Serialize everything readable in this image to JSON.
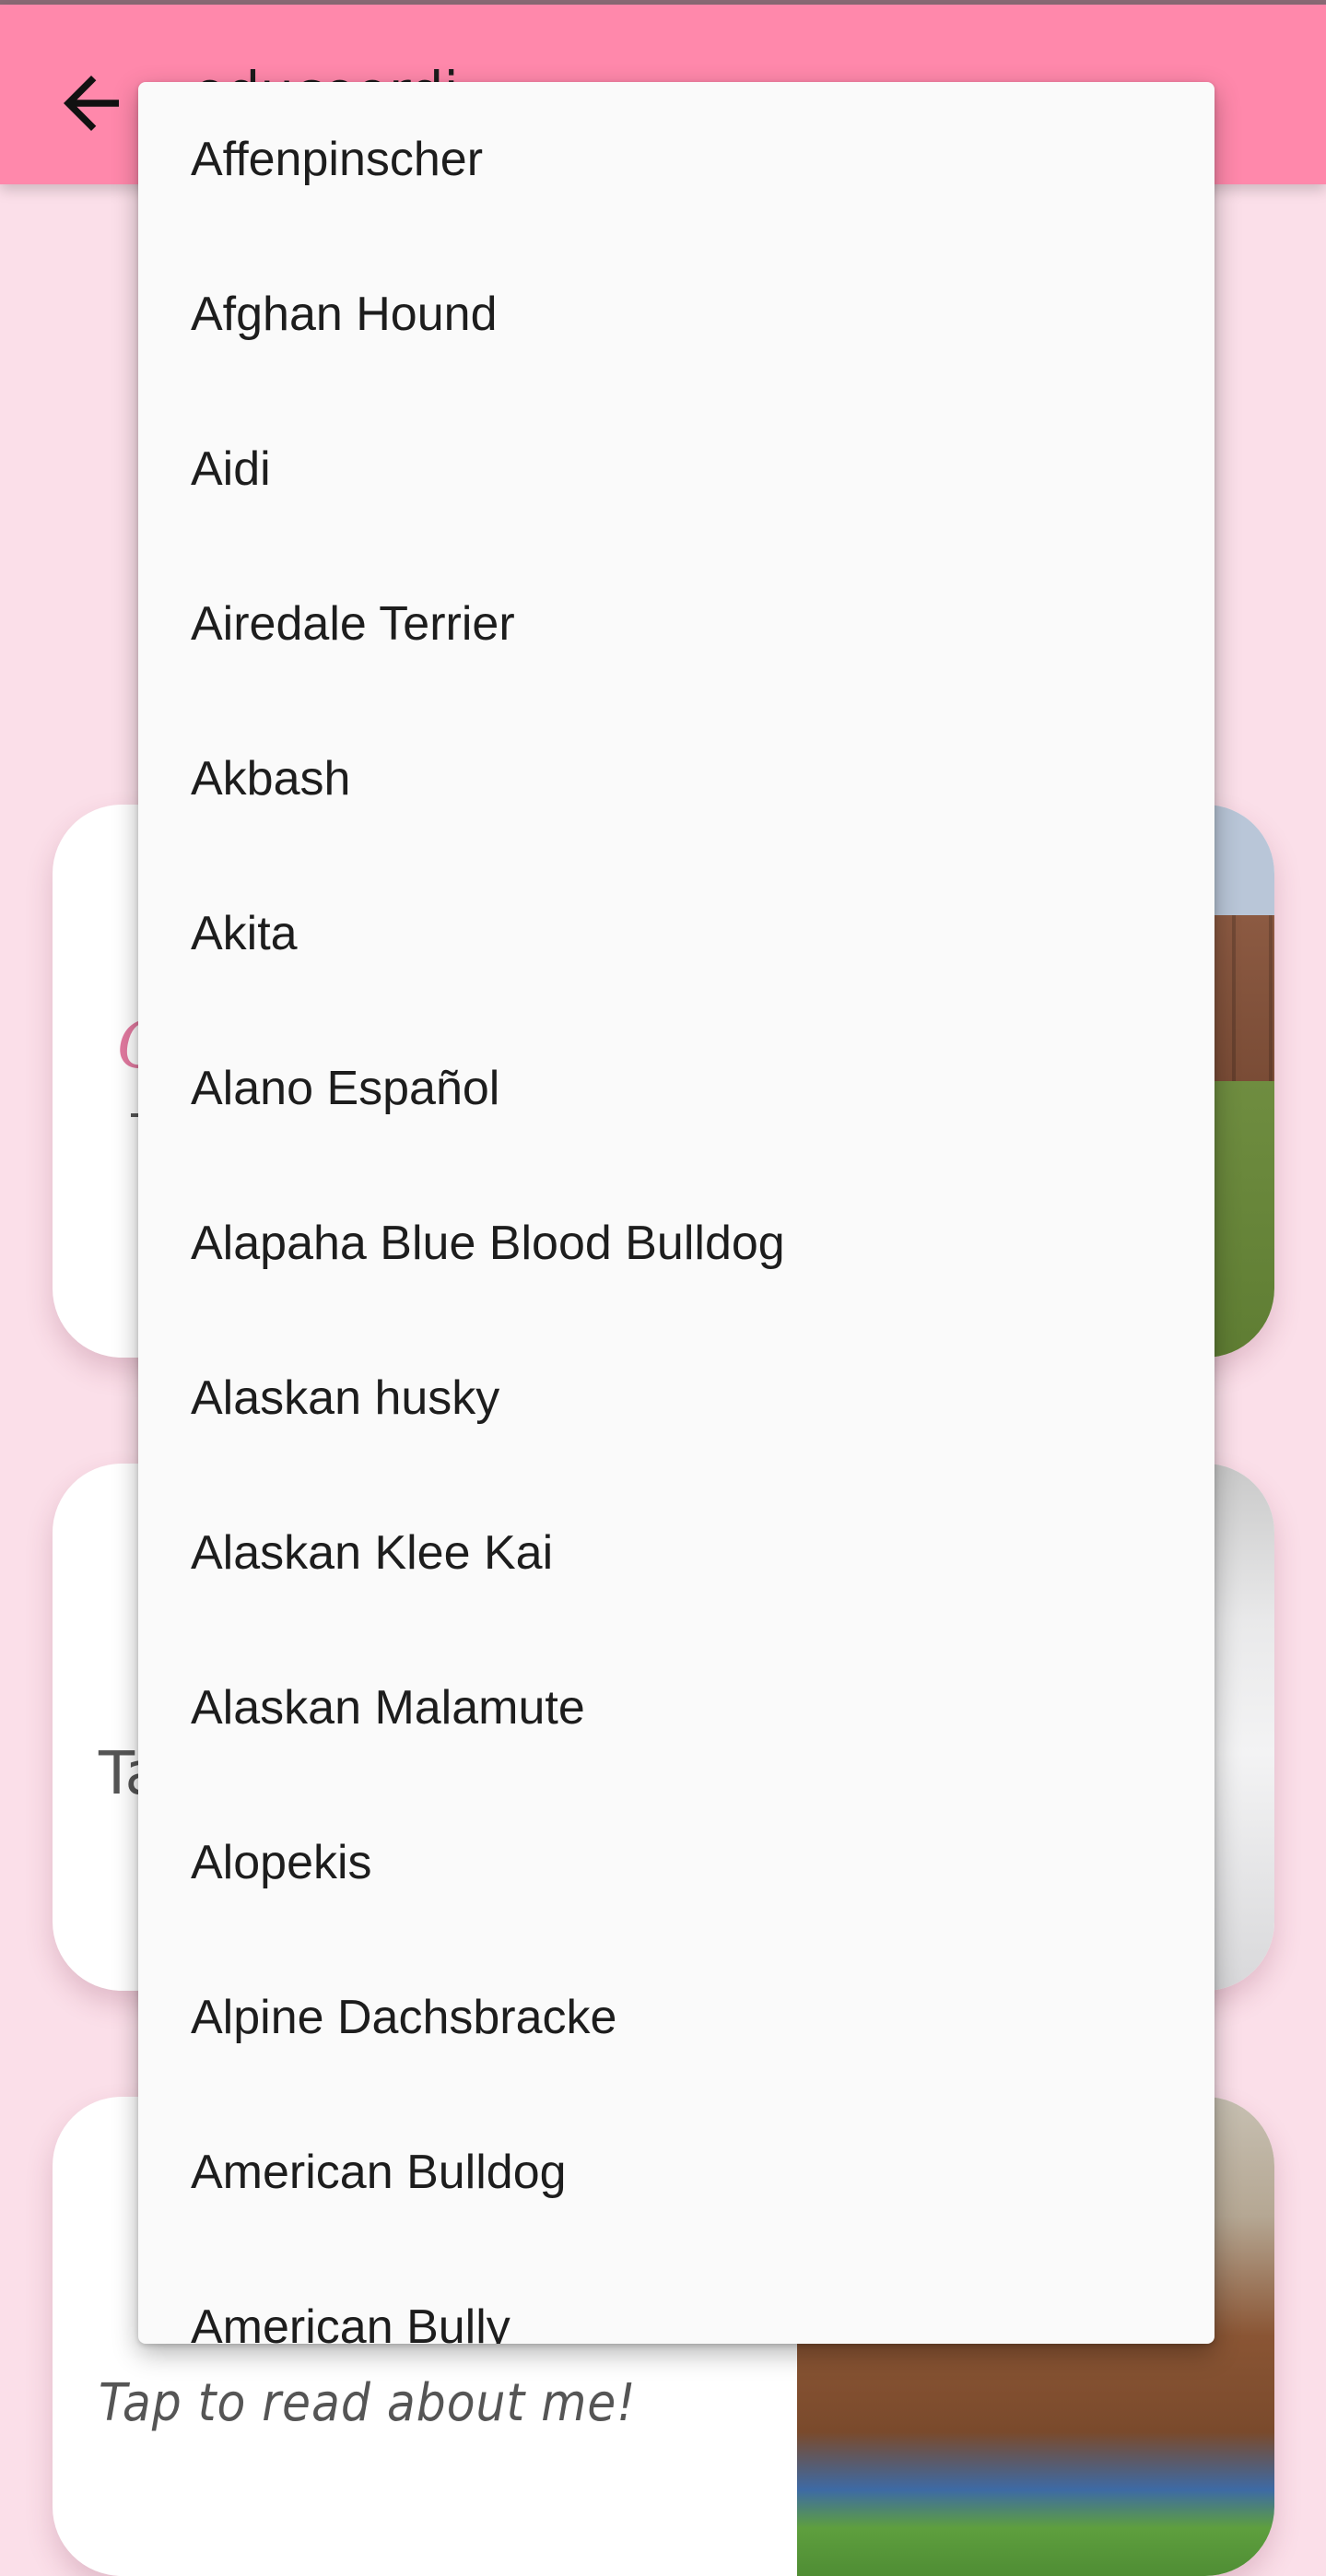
{
  "appbar": {
    "title": "  oducoordi"
  },
  "cards": [
    {
      "script_text": "C"
    },
    {
      "script_text": "Ta"
    },
    {
      "tap_text": "Tap to read about me!"
    }
  ],
  "menu": {
    "items": [
      "Affenpinscher",
      "Afghan Hound",
      "Aidi",
      "Airedale Terrier",
      "Akbash",
      "Akita",
      "Alano Español",
      "Alapaha Blue Blood Bulldog",
      "Alaskan husky",
      "Alaskan Klee Kai",
      "Alaskan Malamute",
      "Alopekis",
      "Alpine Dachsbracke",
      "American Bulldog",
      "American Bully"
    ]
  },
  "colors": {
    "appbar": "#ff88ab",
    "background": "#fbdfe9",
    "menu": "#fafafa"
  },
  "icons": {
    "back": "arrow-back-icon"
  }
}
